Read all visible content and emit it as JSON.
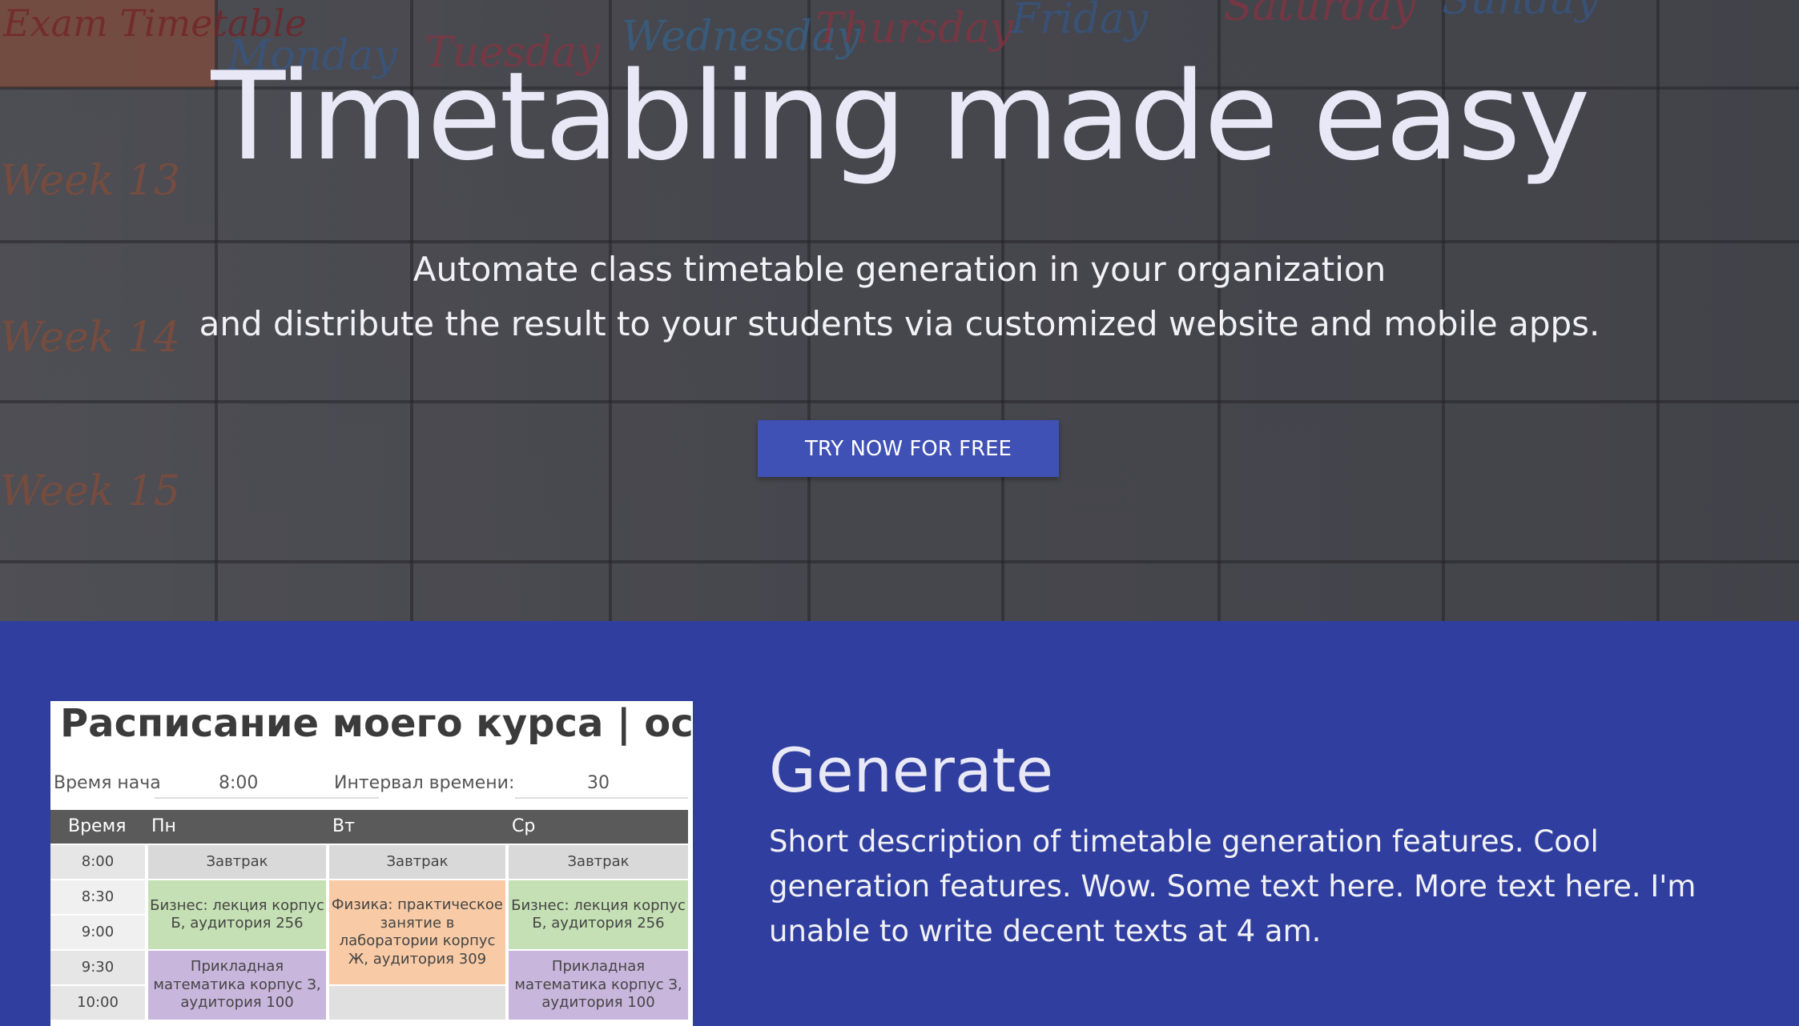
{
  "hero": {
    "title": "Timetabling made easy",
    "subtitle_line1": "Automate class timetable generation in your organization",
    "subtitle_line2": "and distribute the result to your students via customized website and mobile apps.",
    "cta_label": "TRY NOW FOR FREE",
    "board_labels": [
      "Exam Timetable",
      "Monday",
      "Tuesday",
      "Wednesday",
      "Thursday",
      "Friday",
      "Saturday",
      "Sunday",
      "Week 13",
      "Week 14",
      "Week 15"
    ]
  },
  "feature": {
    "title": "Generate",
    "description": "Short description of timetable generation features. Cool generation features. Wow. Some text here. More text here. I'm unable to write decent texts at 4 am.",
    "screenshot": {
      "title": "Расписание моего курса | ос",
      "start_label": "Время нача",
      "start_value": "8:00",
      "interval_label": "Интервал времени:",
      "interval_value": "30",
      "headers": [
        "Время",
        "Пн",
        "Вт",
        "Ср"
      ],
      "times": [
        "8:00",
        "8:30",
        "9:00",
        "9:30",
        "10:00"
      ],
      "breakfast": "Завтрак",
      "lecture": "Бизнес: лекция корпус Б, аудитория 256",
      "physics": "Физика: практическое занятие в лаборатории корпус Ж, аудитория 309",
      "applied_math": "Прикладная математика корпус З, аудитория 100"
    }
  },
  "colors": {
    "brand": "#303f9f",
    "cta": "#3f51b5",
    "hero_text": "#e8e8f6"
  }
}
